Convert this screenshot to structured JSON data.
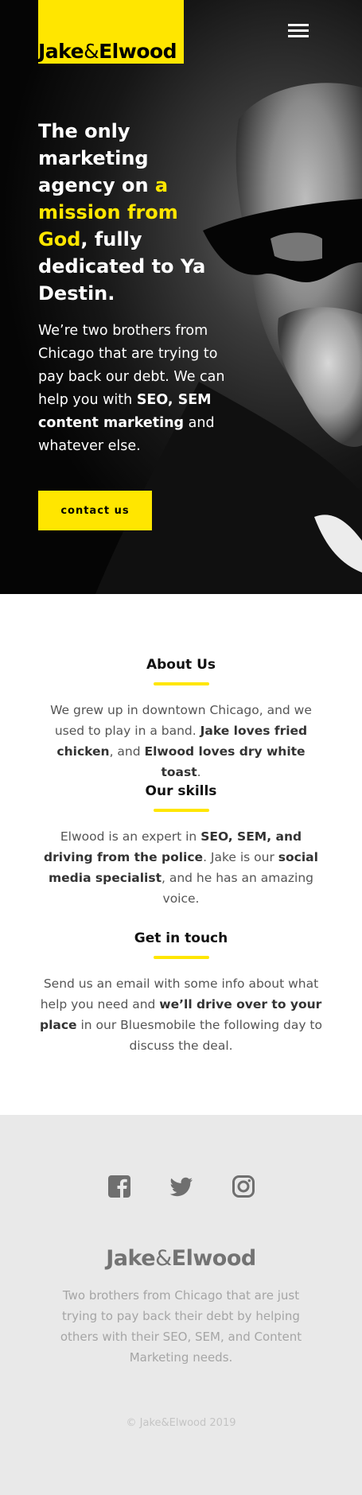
{
  "header": {
    "logo_jake": "Jake",
    "logo_amp": "&",
    "logo_elwood": "Elwood",
    "menu_icon": "hamburger-menu-icon"
  },
  "hero": {
    "title_part1": "The only marketing agency on ",
    "title_highlight": "a mission from God",
    "title_part2": ", fully dedicated to Ya Destin.",
    "text_part1": "We’re two brothers from Chicago that are trying to pay back our debt. We can help you with ",
    "text_bold": "SEO, SEM content marketing",
    "text_part2": " and whatever else.",
    "cta_label": "contact us"
  },
  "about": {
    "title": "About Us",
    "body_part1": "We grew up in downtown Chicago, and we used to play in a band. ",
    "body_bold1": "Jake loves fried chicken",
    "body_part2": ", and ",
    "body_bold2": "Elwood loves dry white toast",
    "body_part3": "."
  },
  "skills": {
    "title": "Our skills",
    "body_part1": "Elwood is an expert in ",
    "body_bold1": "SEO, SEM, and driving from the police",
    "body_part2": ". Jake is our ",
    "body_bold2": "social media specialist",
    "body_part3": ", and he has an amazing voice."
  },
  "contact": {
    "title": "Get in touch",
    "body_part1": "Send us an email with some info about what help you need and ",
    "body_bold1": "we’ll drive over to your place",
    "body_part2": " in our Bluesmobile the following day to discuss the deal."
  },
  "footer": {
    "social_icons": [
      "facebook-icon",
      "twitter-icon",
      "instagram-icon"
    ],
    "logo_jake": "Jake",
    "logo_amp": "&",
    "logo_elwood": "Elwood",
    "tagline": "Two brothers from Chicago that are just trying to pay back their debt by helping others with their SEO, SEM, and Content Marketing needs.",
    "copyright": "© Jake&Elwood 2019"
  },
  "colors": {
    "accent": "#ffe600",
    "hero_bg": "#0a0a0a",
    "footer_bg": "#e9e9e9",
    "text": "#555555"
  }
}
